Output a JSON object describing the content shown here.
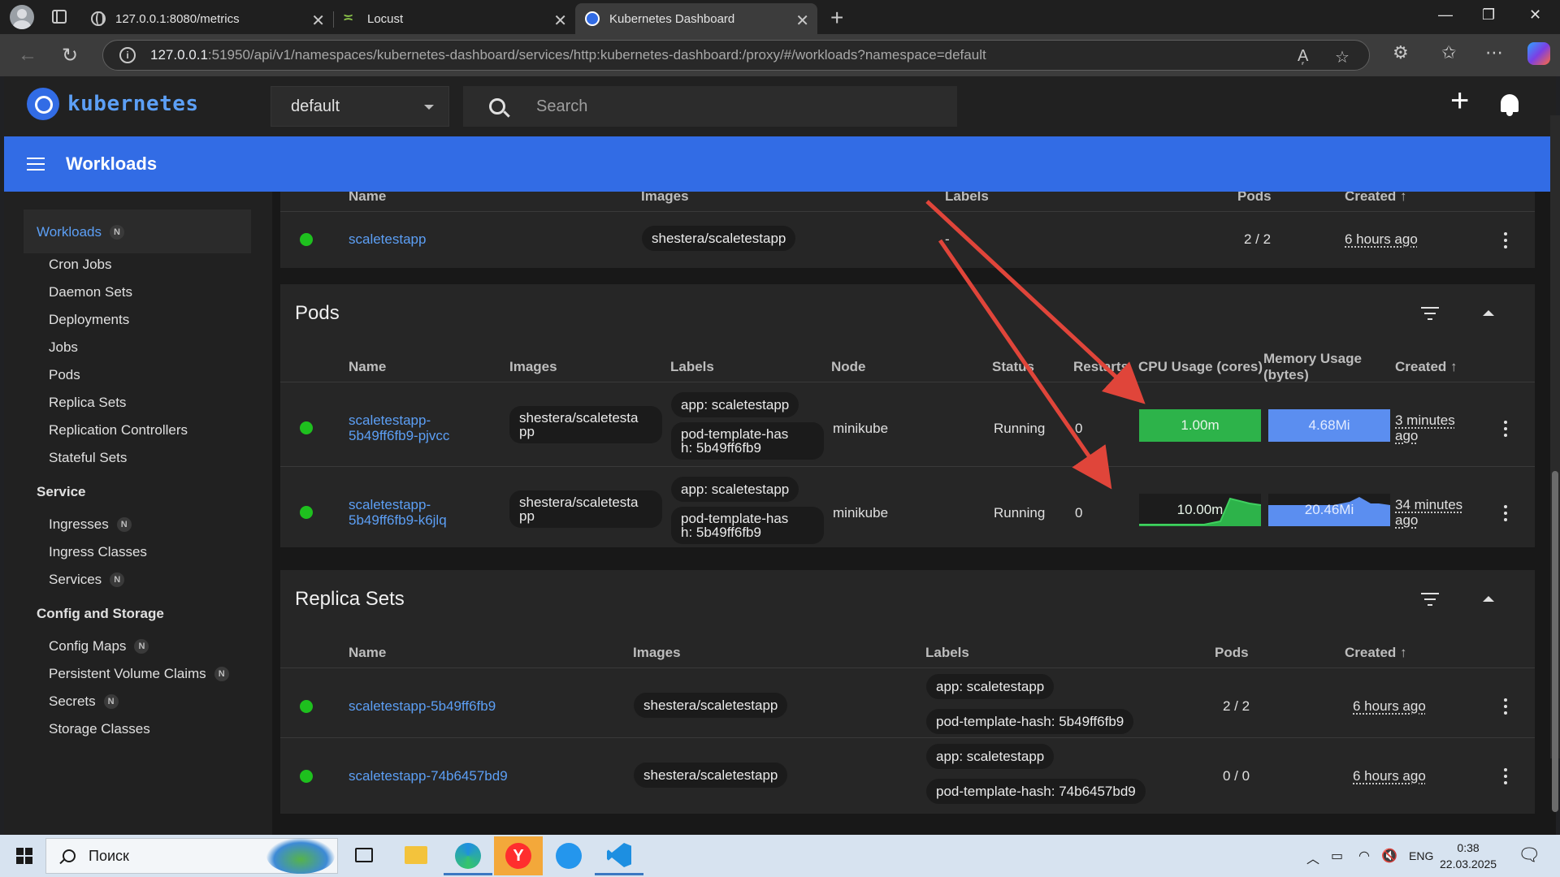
{
  "browser": {
    "tabs": [
      {
        "title": "127.0.0.1:8080/metrics"
      },
      {
        "title": "Locust"
      },
      {
        "title": "Kubernetes Dashboard"
      }
    ],
    "url_host": "127.0.0.1",
    "url_rest": ":51950/api/v1/namespaces/kubernetes-dashboard/services/http:kubernetes-dashboard:/proxy/#/workloads?namespace=default"
  },
  "header": {
    "logo_text": "kubernetes",
    "namespace": "default",
    "search_placeholder": "Search",
    "page_title": "Workloads"
  },
  "sidebar": {
    "workloads": "Workloads",
    "badge": "N",
    "workload_items": [
      "Cron Jobs",
      "Daemon Sets",
      "Deployments",
      "Jobs",
      "Pods",
      "Replica Sets",
      "Replication Controllers",
      "Stateful Sets"
    ],
    "service": "Service",
    "service_items": [
      "Ingresses",
      "Ingress Classes",
      "Services"
    ],
    "config": "Config and Storage",
    "config_items": [
      "Config Maps",
      "Persistent Volume Claims",
      "Secrets",
      "Storage Classes"
    ]
  },
  "deployments": {
    "headers": {
      "name": "Name",
      "images": "Images",
      "labels": "Labels",
      "pods": "Pods",
      "created": "Created ↑"
    },
    "row": {
      "name": "scaletestapp",
      "image": "shestera/scaletestapp",
      "labels": "-",
      "pods": "2 / 2",
      "created": "6 hours ago"
    }
  },
  "pods": {
    "title": "Pods",
    "headers": {
      "name": "Name",
      "images": "Images",
      "labels": "Labels",
      "node": "Node",
      "status": "Status",
      "restarts": "Restarts",
      "cpu": "CPU Usage (cores)",
      "memory_1": "Memory Usage",
      "memory_2": "(bytes)",
      "created": "Created ↑"
    },
    "rows": [
      {
        "name_1": "scaletestapp-",
        "name_2": "5b49ff6fb9-pjvcc",
        "image_1": "shestera/scaletesta",
        "image_2": "pp",
        "label_app": "app: scaletestapp",
        "label_hash_1": "pod-template-has",
        "label_hash_2": "h: 5b49ff6fb9",
        "node": "minikube",
        "status": "Running",
        "restarts": "0",
        "cpu": "1.00m",
        "memory": "4.68Mi",
        "created_1": "3 minutes",
        "created_2": "ago"
      },
      {
        "name_1": "scaletestapp-",
        "name_2": "5b49ff6fb9-k6jlq",
        "image_1": "shestera/scaletesta",
        "image_2": "pp",
        "label_app": "app: scaletestapp",
        "label_hash_1": "pod-template-has",
        "label_hash_2": "h: 5b49ff6fb9",
        "node": "minikube",
        "status": "Running",
        "restarts": "0",
        "cpu": "10.00m",
        "memory": "20.46Mi",
        "created_1": "34 minutes",
        "created_2": "ago"
      }
    ]
  },
  "replicasets": {
    "title": "Replica Sets",
    "headers": {
      "name": "Name",
      "images": "Images",
      "labels": "Labels",
      "pods": "Pods",
      "created": "Created ↑"
    },
    "rows": [
      {
        "name": "scaletestapp-5b49ff6fb9",
        "image": "shestera/scaletestapp",
        "label_app": "app: scaletestapp",
        "label_hash": "pod-template-hash: 5b49ff6fb9",
        "pods": "2 / 2",
        "created": "6 hours ago"
      },
      {
        "name": "scaletestapp-74b6457bd9",
        "image": "shestera/scaletestapp",
        "label_app": "app: scaletestapp",
        "label_hash": "pod-template-hash: 74b6457bd9",
        "pods": "0 / 0",
        "created": "6 hours ago"
      }
    ]
  },
  "taskbar": {
    "search_text": "Поиск",
    "lang": "ENG",
    "time": "0:38",
    "date": "22.03.2025"
  },
  "colors": {
    "accent": "#326ce5",
    "link": "#5c9ff5",
    "cpu_fill": "#2db34a",
    "mem_fill": "#5b8ef0",
    "running": "#1ec01e",
    "annotation_arrow": "#e0453a"
  }
}
